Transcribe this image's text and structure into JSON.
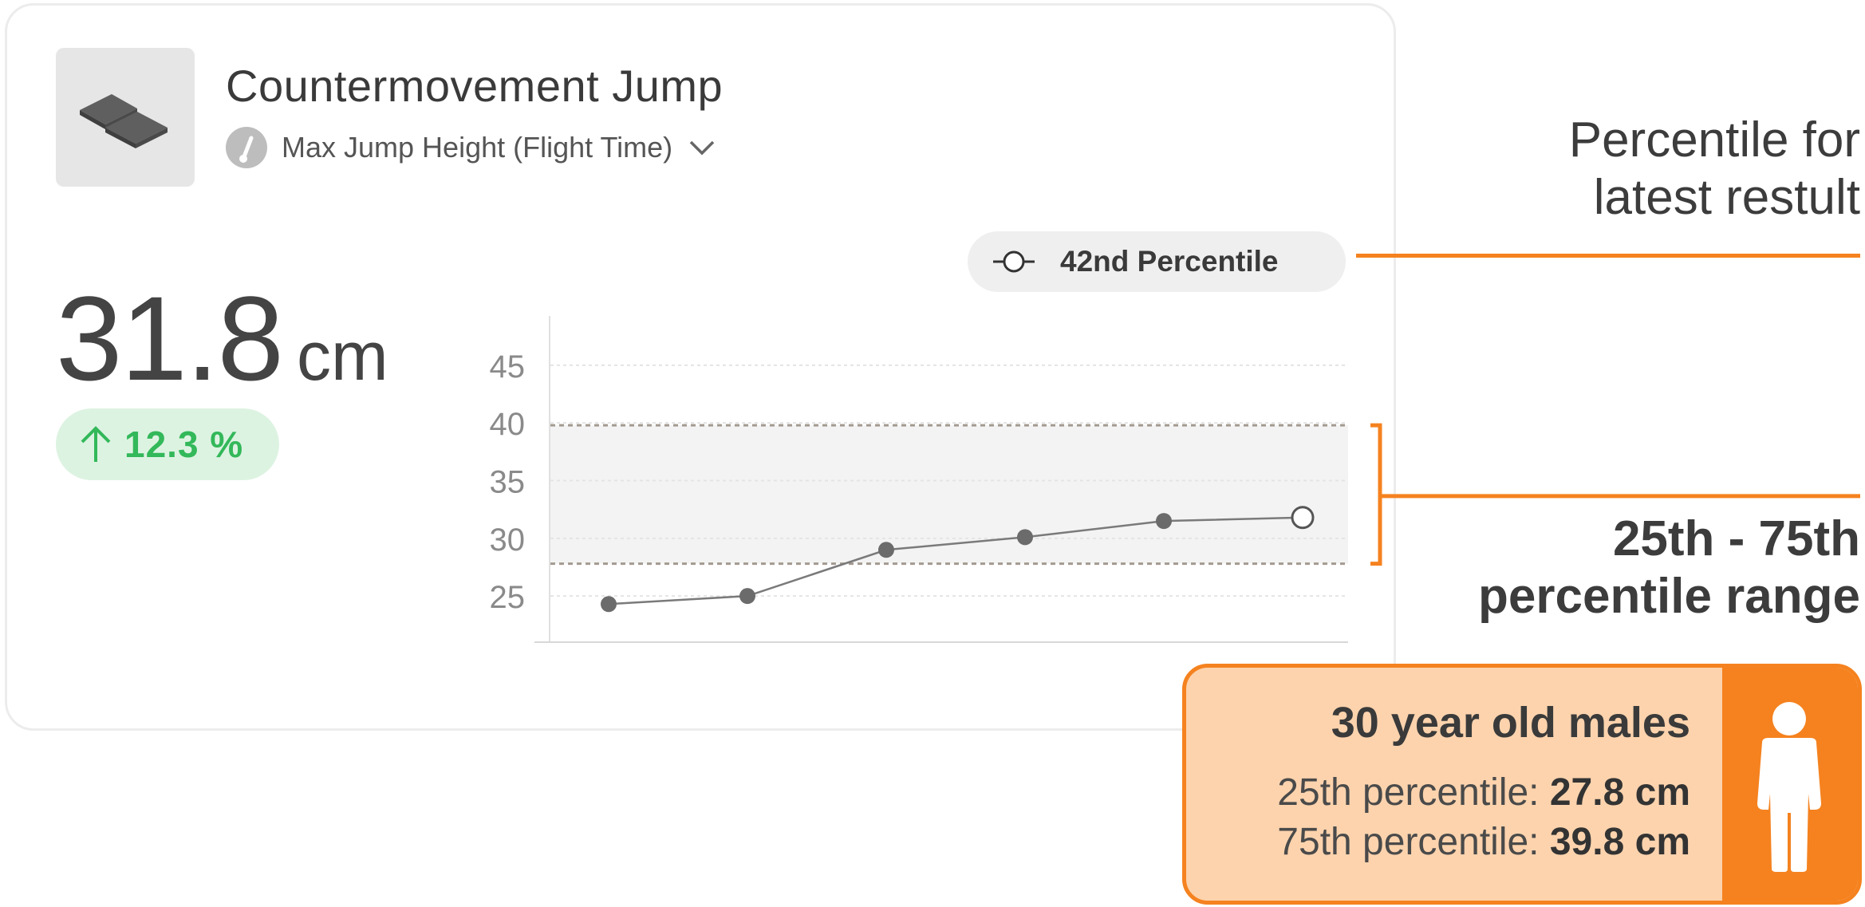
{
  "test": {
    "title": "Countermovement Jump",
    "icon": "force-plates-icon",
    "metric_label": "Max Jump Height (Flight Time)",
    "metric_icon": "gauge-icon",
    "dropdown_icon": "chevron-down-icon"
  },
  "result": {
    "value": "31.8",
    "unit": "cm",
    "change": "12.3 %",
    "change_icon": "arrow-up-icon",
    "change_color": "#33b85a"
  },
  "percentile_badge": {
    "label": "42nd Percentile",
    "icon": "hollow-marker-icon"
  },
  "chart_data": {
    "type": "line",
    "y_ticks": [
      "45",
      "40",
      "35",
      "30",
      "25"
    ],
    "ylim": [
      21,
      49
    ],
    "series": [
      {
        "values": [
          24.3,
          25.0,
          29.0,
          30.1,
          31.5,
          31.8
        ]
      }
    ],
    "latest_marker": "hollow",
    "band": {
      "low": 27.8,
      "high": 39.8
    },
    "grid": true
  },
  "annotations": {
    "latest": [
      "Percentile for",
      "latest restult"
    ],
    "range": [
      "25th - 75th",
      "percentile range"
    ]
  },
  "cohort": {
    "title": "30 year old males",
    "p25_label": "25th percentile: ",
    "p25_value": "27.8 cm",
    "p75_label": "75th percentile: ",
    "p75_value": "39.8 cm",
    "icon": "person-icon"
  },
  "colors": {
    "accent": "#f5821f",
    "band": "#f4f3f4",
    "line": "#6b6b6b"
  }
}
